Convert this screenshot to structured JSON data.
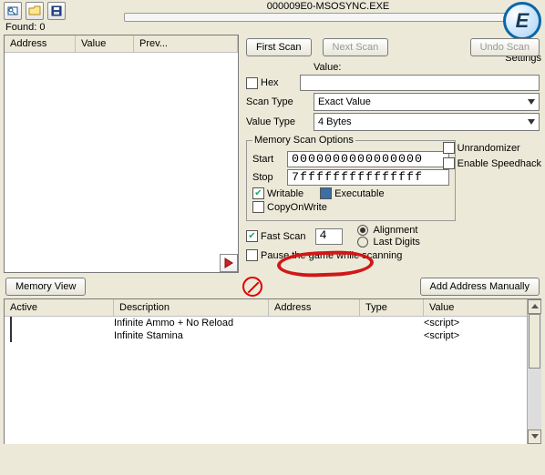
{
  "process": {
    "title": "000009E0-MSOSYNC.EXE"
  },
  "settings_label": "Settings",
  "found": {
    "label": "Found:",
    "count": "0"
  },
  "columns": {
    "address": "Address",
    "value": "Value",
    "prev": "Prev..."
  },
  "buttons": {
    "first_scan": "First Scan",
    "next_scan": "Next Scan",
    "undo_scan": "Undo Scan",
    "memory_view": "Memory View",
    "add_manual": "Add Address Manually"
  },
  "labels": {
    "value": "Value:",
    "hex": "Hex",
    "scan_type": "Scan Type",
    "value_type": "Value Type",
    "mem_opts": "Memory Scan Options",
    "start": "Start",
    "stop": "Stop",
    "writable": "Writable",
    "executable": "Executable",
    "cow": "CopyOnWrite",
    "fast_scan": "Fast Scan",
    "alignment": "Alignment",
    "last_digits": "Last Digits",
    "pause": "Pause the game while scanning",
    "unrandomizer": "Unrandomizer",
    "speedhack": "Enable Speedhack"
  },
  "fields": {
    "value": "",
    "scan_type": "Exact Value",
    "value_type": "4 Bytes",
    "start": "0000000000000000",
    "stop": "7fffffffffffffff",
    "fast_scan_val": "4"
  },
  "bottom": {
    "cols": {
      "active": "Active",
      "desc": "Description",
      "addr": "Address",
      "type": "Type",
      "value": "Value"
    },
    "rows": [
      {
        "desc": "Infinite Ammo + No Reload",
        "value": "<script>"
      },
      {
        "desc": "Infinite Stamina",
        "value": "<script>"
      }
    ]
  }
}
